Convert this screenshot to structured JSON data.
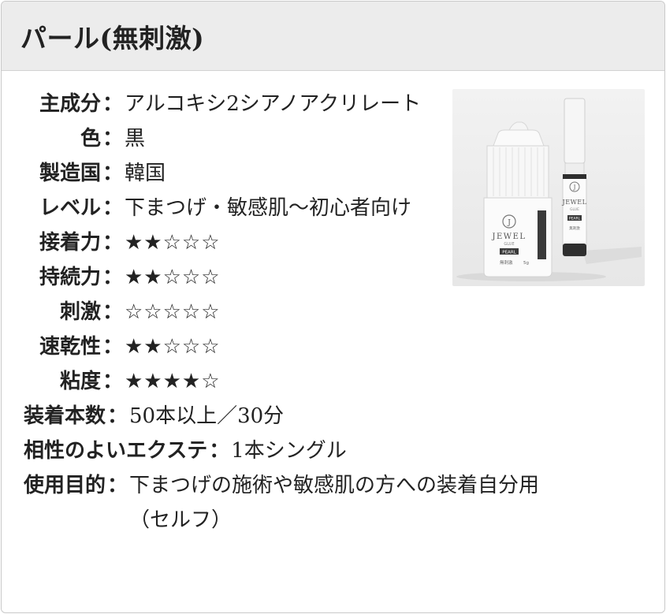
{
  "header": {
    "title": "パール(無刺激)"
  },
  "specs": [
    {
      "label": "主成分",
      "colon": "：",
      "value": "アルコキシ2シアノアクリレート"
    },
    {
      "label": "色",
      "colon": "：",
      "value": "黒"
    },
    {
      "label": "製造国",
      "colon": "：",
      "value": "韓国"
    },
    {
      "label": "レベル",
      "colon": "：",
      "value": "下まつげ・敏感肌〜初心者向け"
    },
    {
      "label": "接着力",
      "colon": "：",
      "value": "★★☆☆☆",
      "rating": 2
    },
    {
      "label": "持続力",
      "colon": "：",
      "value": "★★☆☆☆",
      "rating": 2
    },
    {
      "label": "刺激",
      "colon": "：",
      "value": "☆☆☆☆☆",
      "rating": 0
    },
    {
      "label": "速乾性",
      "colon": "：",
      "value": "★★☆☆☆",
      "rating": 2
    },
    {
      "label": "粘度",
      "colon": "：",
      "value": "★★★★☆",
      "rating": 4
    }
  ],
  "extra": [
    {
      "label": "装着本数",
      "colon": "：",
      "value": "50本以上／30分"
    },
    {
      "label": "相性のよいエクステ",
      "colon": "：",
      "value": "1本シングル"
    },
    {
      "label": "使用目的",
      "colon": "：",
      "value": "下まつげの施術や敏感肌の方への装着自分用（セルフ）"
    }
  ],
  "product_image": {
    "bottle": {
      "logo": "JEWEL",
      "sub": "GLUE",
      "badge": "PEARL",
      "note": "無刺激",
      "size": "5g"
    },
    "tube": {
      "logo": "JEWEL",
      "sub": "GLUE",
      "badge": "PEARL",
      "note": "無刺激"
    }
  }
}
